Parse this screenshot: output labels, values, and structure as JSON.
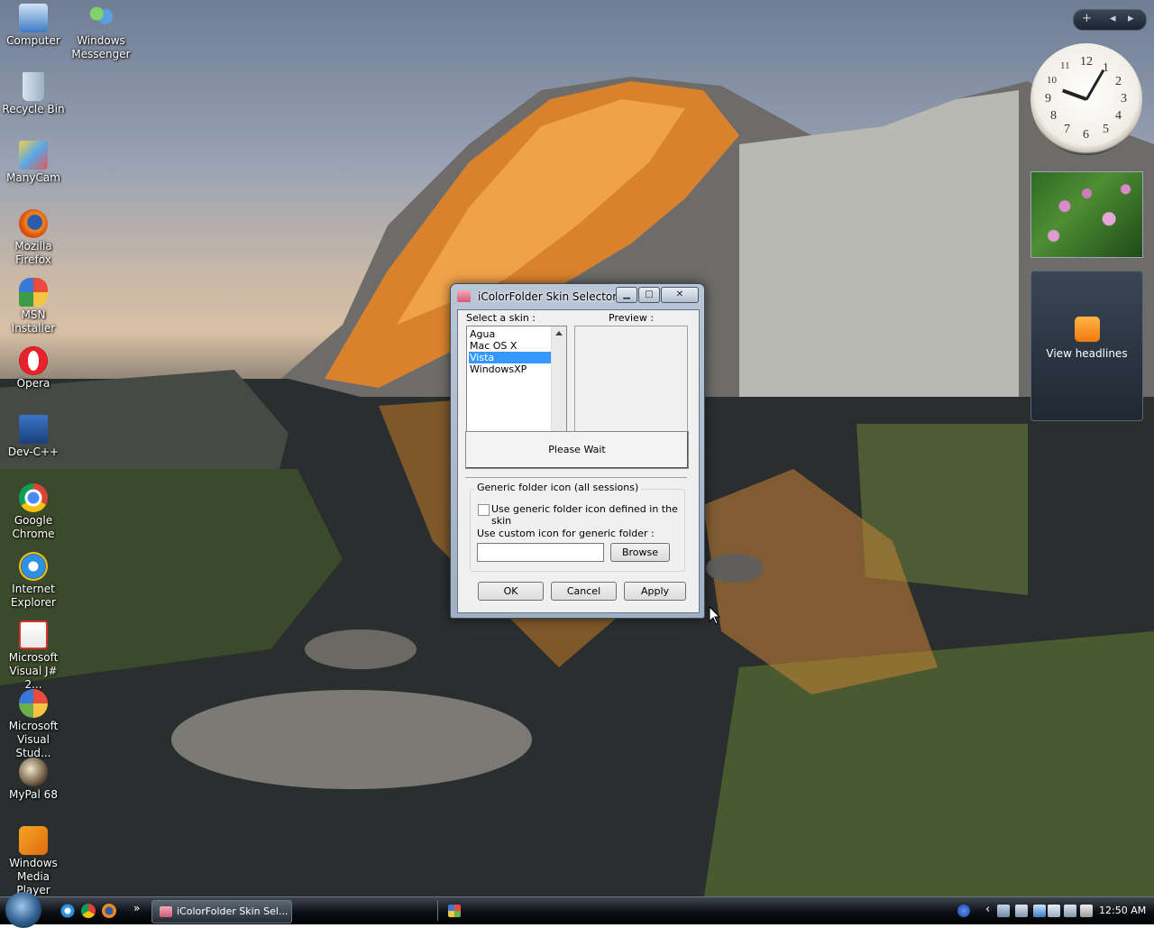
{
  "desktop_icons": [
    {
      "label": "Computer",
      "icon": "computer-icon"
    },
    {
      "label": "Windows Messenger",
      "icon": "messenger-icon"
    },
    {
      "label": "Recycle Bin",
      "icon": "recycle-bin-icon"
    },
    {
      "label": "ManyCam",
      "icon": "manycam-icon"
    },
    {
      "label": "Mozilla Firefox",
      "icon": "firefox-icon"
    },
    {
      "label": "MSN Installer",
      "icon": "msn-icon"
    },
    {
      "label": "Opera",
      "icon": "opera-icon"
    },
    {
      "label": "Dev-C++",
      "icon": "devcpp-icon"
    },
    {
      "label": "Google Chrome",
      "icon": "chrome-icon"
    },
    {
      "label": "Internet Explorer",
      "icon": "ie-icon"
    },
    {
      "label": "Microsoft Visual J# 2...",
      "icon": "visual-j-icon"
    },
    {
      "label": "Microsoft Visual Stud...",
      "icon": "visual-studio-icon"
    },
    {
      "label": "MyPal 68",
      "icon": "mypal-icon"
    },
    {
      "label": "Windows Media Player",
      "icon": "media-player-icon"
    }
  ],
  "gadgets": {
    "bar_add": "+",
    "bar_prev": "◂",
    "bar_next": "▸",
    "clock_numbers": [
      "12",
      "1",
      "2",
      "3",
      "4",
      "5",
      "6",
      "7",
      "8",
      "9",
      "10",
      "11"
    ],
    "feed_label": "View headlines"
  },
  "dialog": {
    "title": "iColorFolder Skin Selector",
    "minimize": "▁",
    "maximize": "□",
    "close": "✕",
    "select_label": "Select a skin :",
    "preview_label": "Preview :",
    "skins": [
      "Agua",
      "Mac OS X",
      "Vista",
      "WindowsXP"
    ],
    "selected_skin": "Vista",
    "wait_label": "Please Wait",
    "group_title": "Generic folder icon (all sessions)",
    "checkbox_label": "Use generic folder icon defined in the skin",
    "custom_label": "Use custom icon for generic folder :",
    "custom_value": "",
    "browse_label": "Browse",
    "ok_label": "OK",
    "cancel_label": "Cancel",
    "apply_label": "Apply"
  },
  "taskbar": {
    "chevron": "»",
    "task_label": "iColorFolder Skin Sel...",
    "tray_chevron": "‹",
    "clock": "12:50 AM"
  }
}
